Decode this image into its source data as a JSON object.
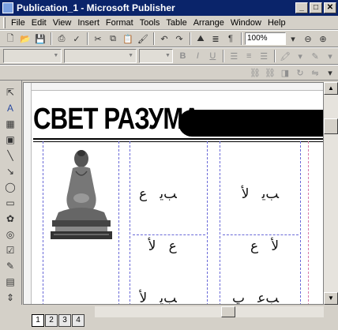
{
  "window": {
    "title": "Publication_1 - Microsoft Publisher",
    "controls": [
      "_",
      "□",
      "✕"
    ]
  },
  "menu": [
    "File",
    "Edit",
    "View",
    "Insert",
    "Format",
    "Tools",
    "Table",
    "Arrange",
    "Window",
    "Help"
  ],
  "toolbar": {
    "zoom": "100%"
  },
  "document": {
    "heading": "СВЕТ РАЗУМА",
    "col1_lines": [
      "ﺐﻳ   ﻉ",
      "ﻉ   ﻷ",
      "ﺐﻳ   ﻷ"
    ],
    "col2_lines": [
      "ﺐﻳ   ﻷ",
      "ﻷ   ﻉ",
      "ﺐﻋ   ﭖ"
    ]
  },
  "page_tabs": [
    "1",
    "2",
    "3",
    "4"
  ],
  "active_page": "1"
}
